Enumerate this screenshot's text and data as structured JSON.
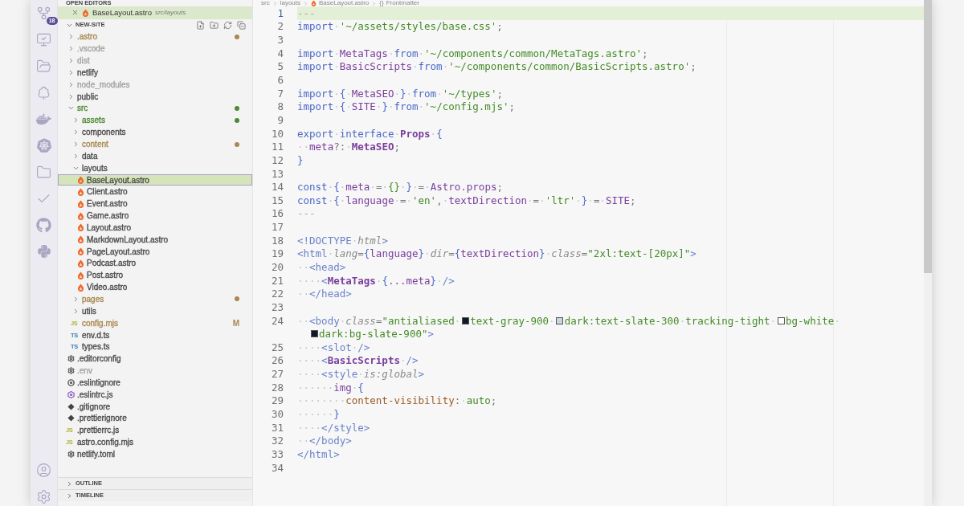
{
  "activity_bar": {
    "source_control_badge": "18"
  },
  "sidebar": {
    "open_editors": {
      "title": "OPEN EDITORS",
      "items": [
        {
          "name": "BaseLayout.astro",
          "description": "src/layouts",
          "kind": "astro",
          "selected": true
        }
      ]
    },
    "explorer": {
      "title": "NEW-SITE",
      "expanded": true,
      "items": [
        {
          "name": ".astro",
          "kind": "folder",
          "expanded": false,
          "selected": false,
          "color": "#a8884f",
          "dot": true
        },
        {
          "name": ".vscode",
          "kind": "folder",
          "expanded": false,
          "selected": false,
          "color": "#a3a3a3"
        },
        {
          "name": "dist",
          "kind": "folder",
          "expanded": false,
          "selected": false,
          "color": "#a3a3a3"
        },
        {
          "name": "netlify",
          "kind": "folder",
          "expanded": false,
          "selected": false,
          "color": "#4a4a4a"
        },
        {
          "name": "node_modules",
          "kind": "folder",
          "expanded": false,
          "selected": false,
          "color": "#a3a3a3"
        },
        {
          "name": "public",
          "kind": "folder",
          "expanded": false,
          "selected": false,
          "color": "#4a4a4a"
        },
        {
          "name": "src",
          "kind": "folder",
          "expanded": true,
          "selected": false,
          "color": "#4e8a34",
          "dot": true,
          "children": [
            {
              "name": "assets",
              "kind": "folder",
              "expanded": false,
              "selected": false,
              "color": "#4e8a34",
              "dot": true
            },
            {
              "name": "components",
              "kind": "folder",
              "expanded": false,
              "selected": false,
              "color": "#4a4a4a"
            },
            {
              "name": "content",
              "kind": "folder",
              "expanded": false,
              "selected": false,
              "color": "#a8884f",
              "dot": true
            },
            {
              "name": "data",
              "kind": "folder",
              "expanded": false,
              "selected": false,
              "color": "#4a4a4a"
            },
            {
              "name": "layouts",
              "kind": "folder",
              "expanded": true,
              "selected": false,
              "color": "#4a4a4a",
              "children": [
                {
                  "name": "BaseLayout.astro",
                  "kind": "astro",
                  "selected": true,
                  "color": "#4a4a4a"
                },
                {
                  "name": "Client.astro",
                  "kind": "astro",
                  "selected": false,
                  "color": "#4a4a4a"
                },
                {
                  "name": "Event.astro",
                  "kind": "astro",
                  "selected": false,
                  "color": "#4a4a4a"
                },
                {
                  "name": "Game.astro",
                  "kind": "astro",
                  "selected": false,
                  "color": "#4a4a4a"
                },
                {
                  "name": "Layout.astro",
                  "kind": "astro",
                  "selected": false,
                  "color": "#4a4a4a"
                },
                {
                  "name": "MarkdownLayout.astro",
                  "kind": "astro",
                  "selected": false,
                  "color": "#4a4a4a"
                },
                {
                  "name": "PageLayout.astro",
                  "kind": "astro",
                  "selected": false,
                  "color": "#4a4a4a"
                },
                {
                  "name": "Podcast.astro",
                  "kind": "astro",
                  "selected": false,
                  "color": "#4a4a4a"
                },
                {
                  "name": "Post.astro",
                  "kind": "astro",
                  "selected": false,
                  "color": "#4a4a4a"
                },
                {
                  "name": "Video.astro",
                  "kind": "astro",
                  "selected": false,
                  "color": "#4a4a4a"
                }
              ]
            },
            {
              "name": "pages",
              "kind": "folder",
              "expanded": false,
              "selected": false,
              "color": "#a8884f",
              "dot": true
            },
            {
              "name": "utils",
              "kind": "folder",
              "expanded": false,
              "selected": false,
              "color": "#4a4a4a"
            },
            {
              "name": "config.mjs",
              "kind": "script",
              "icon": "JS",
              "selected": false,
              "color": "#a8884f",
              "badge": "M"
            },
            {
              "name": "env.d.ts",
              "kind": "typescript",
              "icon": "TS",
              "selected": false,
              "color": "#4a4a4a"
            },
            {
              "name": "types.ts",
              "kind": "typescript",
              "icon": "TS",
              "selected": false,
              "color": "#4a4a4a"
            }
          ]
        },
        {
          "name": ".editorconfig",
          "kind": "config",
          "selected": false,
          "color": "#4a4a4a"
        },
        {
          "name": ".env",
          "kind": "config",
          "selected": false,
          "color": "#a3a3a3"
        },
        {
          "name": ".eslintignore",
          "kind": "eslintignore",
          "selected": false,
          "color": "#4a4a4a"
        },
        {
          "name": ".eslintrc.js",
          "kind": "eslint",
          "selected": false,
          "color": "#4a4a4a"
        },
        {
          "name": ".gitignore",
          "kind": "git",
          "selected": false,
          "color": "#4a4a4a"
        },
        {
          "name": ".prettierignore",
          "kind": "git",
          "selected": false,
          "color": "#4a4a4a"
        },
        {
          "name": ".prettierrc.js",
          "kind": "script",
          "icon": "JS",
          "selected": false,
          "color": "#4a4a4a"
        },
        {
          "name": "astro.config.mjs",
          "kind": "script",
          "icon": "JS",
          "selected": false,
          "color": "#4a4a4a"
        },
        {
          "name": "netlify.toml",
          "kind": "config",
          "selected": false,
          "color": "#4a4a4a"
        }
      ]
    },
    "panels": [
      {
        "title": "OUTLINE",
        "expanded": false
      },
      {
        "title": "TIMELINE",
        "expanded": false
      }
    ]
  },
  "editor": {
    "breadcrumbs": [
      {
        "label": "src",
        "kind": "folder"
      },
      {
        "label": "layouts",
        "kind": "folder"
      },
      {
        "label": "BaseLayout.astro",
        "kind": "astro"
      },
      {
        "label": "Frontmatter",
        "kind": "symbol",
        "icon": "{}"
      }
    ],
    "lines": [
      {
        "n": "1",
        "active": true,
        "tokens": [
          {
            "kind": "dim",
            "t": "---"
          }
        ]
      },
      {
        "n": "2",
        "active": false,
        "tokens": [
          {
            "kind": "kw",
            "t": "import"
          },
          {
            "kind": "ws",
            "t": "·"
          },
          {
            "kind": "str",
            "t": "'~/assets/styles/base.css'"
          },
          {
            "kind": "p",
            "t": ";"
          }
        ]
      },
      {
        "n": "3",
        "active": false
      },
      {
        "n": "4",
        "active": false,
        "tokens": [
          {
            "kind": "kw",
            "t": "import"
          },
          {
            "kind": "ws",
            "t": "·"
          },
          {
            "kind": "id",
            "t": "MetaTags"
          },
          {
            "kind": "ws",
            "t": "·"
          },
          {
            "kind": "kw",
            "t": "from"
          },
          {
            "kind": "ws",
            "t": "·"
          },
          {
            "kind": "str",
            "t": "'~/components/common/MetaTags.astro'"
          },
          {
            "kind": "p",
            "t": ";"
          }
        ]
      },
      {
        "n": "5",
        "active": false,
        "tokens": [
          {
            "kind": "kw",
            "t": "import"
          },
          {
            "kind": "ws",
            "t": "·"
          },
          {
            "kind": "id",
            "t": "BasicScripts"
          },
          {
            "kind": "ws",
            "t": "·"
          },
          {
            "kind": "kw",
            "t": "from"
          },
          {
            "kind": "ws",
            "t": "·"
          },
          {
            "kind": "str",
            "t": "'~/components/common/BasicScripts.astro'"
          },
          {
            "kind": "p",
            "t": ";"
          }
        ]
      },
      {
        "n": "6",
        "active": false
      },
      {
        "n": "7",
        "active": false,
        "tokens": [
          {
            "kind": "kw",
            "t": "import"
          },
          {
            "kind": "ws",
            "t": "·"
          },
          {
            "kind": "brace",
            "t": "{"
          },
          {
            "kind": "ws",
            "t": "·"
          },
          {
            "kind": "id",
            "t": "MetaSEO"
          },
          {
            "kind": "ws",
            "t": "·"
          },
          {
            "kind": "brace",
            "t": "}"
          },
          {
            "kind": "ws",
            "t": "·"
          },
          {
            "kind": "kw",
            "t": "from"
          },
          {
            "kind": "ws",
            "t": "·"
          },
          {
            "kind": "str",
            "t": "'~/types'"
          },
          {
            "kind": "p",
            "t": ";"
          }
        ]
      },
      {
        "n": "8",
        "active": false,
        "tokens": [
          {
            "kind": "kw",
            "t": "import"
          },
          {
            "kind": "ws",
            "t": "·"
          },
          {
            "kind": "brace",
            "t": "{"
          },
          {
            "kind": "ws",
            "t": "·"
          },
          {
            "kind": "id",
            "t": "SITE"
          },
          {
            "kind": "ws",
            "t": "·"
          },
          {
            "kind": "brace",
            "t": "}"
          },
          {
            "kind": "ws",
            "t": "·"
          },
          {
            "kind": "kw",
            "t": "from"
          },
          {
            "kind": "ws",
            "t": "·"
          },
          {
            "kind": "str",
            "t": "'~/config.mjs'"
          },
          {
            "kind": "p",
            "t": ";"
          }
        ]
      },
      {
        "n": "9",
        "active": false
      },
      {
        "n": "10",
        "active": false,
        "tokens": [
          {
            "kind": "kw",
            "t": "export"
          },
          {
            "kind": "ws",
            "t": "·"
          },
          {
            "kind": "kw",
            "t": "interface"
          },
          {
            "kind": "ws",
            "t": "·"
          },
          {
            "kind": "type",
            "t": "Props"
          },
          {
            "kind": "ws",
            "t": "·"
          },
          {
            "kind": "brace",
            "t": "{"
          }
        ]
      },
      {
        "n": "11",
        "active": false,
        "tokens": [
          {
            "kind": "ws",
            "t": "··"
          },
          {
            "kind": "id",
            "t": "meta"
          },
          {
            "kind": "p",
            "t": "?:"
          },
          {
            "kind": "ws",
            "t": "·"
          },
          {
            "kind": "type",
            "t": "MetaSEO"
          },
          {
            "kind": "p",
            "t": ";"
          }
        ]
      },
      {
        "n": "12",
        "active": false,
        "tokens": [
          {
            "kind": "brace",
            "t": "}"
          }
        ]
      },
      {
        "n": "13",
        "active": false
      },
      {
        "n": "14",
        "active": false,
        "tokens": [
          {
            "kind": "kw",
            "t": "const"
          },
          {
            "kind": "ws",
            "t": "·"
          },
          {
            "kind": "brace",
            "t": "{"
          },
          {
            "kind": "ws",
            "t": "·"
          },
          {
            "kind": "id",
            "t": "meta"
          },
          {
            "kind": "ws",
            "t": "·"
          },
          {
            "kind": "p",
            "t": "="
          },
          {
            "kind": "ws",
            "t": "·"
          },
          {
            "kind": "str",
            "t": "{}"
          },
          {
            "kind": "ws",
            "t": "·"
          },
          {
            "kind": "brace",
            "t": "}"
          },
          {
            "kind": "ws",
            "t": "·"
          },
          {
            "kind": "p",
            "t": "="
          },
          {
            "kind": "ws",
            "t": "·"
          },
          {
            "kind": "id",
            "t": "Astro.props"
          },
          {
            "kind": "p",
            "t": ";"
          }
        ]
      },
      {
        "n": "15",
        "active": false,
        "tokens": [
          {
            "kind": "kw",
            "t": "const"
          },
          {
            "kind": "ws",
            "t": "·"
          },
          {
            "kind": "brace",
            "t": "{"
          },
          {
            "kind": "ws",
            "t": "·"
          },
          {
            "kind": "id",
            "t": "language"
          },
          {
            "kind": "ws",
            "t": "·"
          },
          {
            "kind": "p",
            "t": "="
          },
          {
            "kind": "ws",
            "t": "·"
          },
          {
            "kind": "str",
            "t": "'en'"
          },
          {
            "kind": "p",
            "t": ","
          },
          {
            "kind": "ws",
            "t": "·"
          },
          {
            "kind": "id",
            "t": "textDirection"
          },
          {
            "kind": "ws",
            "t": "·"
          },
          {
            "kind": "p",
            "t": "="
          },
          {
            "kind": "ws",
            "t": "·"
          },
          {
            "kind": "str",
            "t": "'ltr'"
          },
          {
            "kind": "ws",
            "t": "·"
          },
          {
            "kind": "brace",
            "t": "}"
          },
          {
            "kind": "ws",
            "t": "·"
          },
          {
            "kind": "p",
            "t": "="
          },
          {
            "kind": "ws",
            "t": "·"
          },
          {
            "kind": "id",
            "t": "SITE"
          },
          {
            "kind": "p",
            "t": ";"
          }
        ]
      },
      {
        "n": "16",
        "active": false,
        "tokens": [
          {
            "kind": "dim",
            "t": "---"
          }
        ]
      },
      {
        "n": "17",
        "active": false
      },
      {
        "n": "18",
        "active": false,
        "tokens": [
          {
            "kind": "tag",
            "t": "<!DOCTYPE"
          },
          {
            "kind": "ws",
            "t": "·"
          },
          {
            "kind": "attr",
            "t": "html"
          },
          {
            "kind": "tag",
            "t": ">"
          }
        ]
      },
      {
        "n": "19",
        "active": false,
        "tokens": [
          {
            "kind": "tag",
            "t": "<html"
          },
          {
            "kind": "ws",
            "t": "·"
          },
          {
            "kind": "attr",
            "t": "lang"
          },
          {
            "kind": "p",
            "t": "="
          },
          {
            "kind": "brace",
            "t": "{"
          },
          {
            "kind": "id",
            "t": "language"
          },
          {
            "kind": "brace",
            "t": "}"
          },
          {
            "kind": "ws",
            "t": "·"
          },
          {
            "kind": "attr",
            "t": "dir"
          },
          {
            "kind": "p",
            "t": "="
          },
          {
            "kind": "brace",
            "t": "{"
          },
          {
            "kind": "id",
            "t": "textDirection"
          },
          {
            "kind": "brace",
            "t": "}"
          },
          {
            "kind": "ws",
            "t": "·"
          },
          {
            "kind": "attr",
            "t": "class"
          },
          {
            "kind": "p",
            "t": "="
          },
          {
            "kind": "str",
            "t": "\"2xl:text-[20px]\""
          },
          {
            "kind": "tag",
            "t": ">"
          }
        ]
      },
      {
        "n": "20",
        "active": false,
        "tokens": [
          {
            "kind": "ws",
            "t": "··"
          },
          {
            "kind": "tag",
            "t": "<head>"
          }
        ]
      },
      {
        "n": "21",
        "active": false,
        "tokens": [
          {
            "kind": "ws",
            "t": "····"
          },
          {
            "kind": "tag",
            "t": "<"
          },
          {
            "kind": "type",
            "t": "MetaTags"
          },
          {
            "kind": "ws",
            "t": "·"
          },
          {
            "kind": "brace",
            "t": "{"
          },
          {
            "kind": "id",
            "t": "...meta"
          },
          {
            "kind": "brace",
            "t": "}"
          },
          {
            "kind": "ws",
            "t": "·"
          },
          {
            "kind": "tag",
            "t": "/>"
          }
        ]
      },
      {
        "n": "22",
        "active": false,
        "tokens": [
          {
            "kind": "ws",
            "t": "··"
          },
          {
            "kind": "tag",
            "t": "</head>"
          }
        ]
      },
      {
        "n": "23",
        "active": false
      },
      {
        "n": "24",
        "active": false,
        "tokens": [
          {
            "kind": "ws",
            "t": "··"
          },
          {
            "kind": "tag",
            "t": "<body"
          },
          {
            "kind": "ws",
            "t": "·"
          },
          {
            "kind": "attr",
            "t": "class"
          },
          {
            "kind": "p",
            "t": "="
          },
          {
            "kind": "str",
            "t": "\"antialiased"
          },
          {
            "kind": "ws",
            "t": "·"
          },
          {
            "kind": "swatch",
            "color": "#111827"
          },
          {
            "kind": "str",
            "t": "text-gray-900"
          },
          {
            "kind": "ws",
            "t": "·"
          },
          {
            "kind": "swatch",
            "color": "#cbd5e1"
          },
          {
            "kind": "str",
            "t": "dark:text-slate-300"
          },
          {
            "kind": "ws",
            "t": "·"
          },
          {
            "kind": "str",
            "t": "tracking-tight"
          },
          {
            "kind": "ws",
            "t": "·"
          },
          {
            "kind": "swatch",
            "color": "#ffffff"
          },
          {
            "kind": "str",
            "t": "bg-white"
          },
          {
            "kind": "ws",
            "t": "·"
          }
        ],
        "wrap": [
          {
            "kind": "swatch",
            "color": "#0f172a"
          },
          {
            "kind": "str",
            "t": "dark:bg-slate-900\""
          },
          {
            "kind": "tag",
            "t": ">"
          }
        ]
      },
      {
        "n": "25",
        "active": false,
        "tokens": [
          {
            "kind": "ws",
            "t": "····"
          },
          {
            "kind": "tag",
            "t": "<slot"
          },
          {
            "kind": "ws",
            "t": "·"
          },
          {
            "kind": "tag",
            "t": "/>"
          }
        ]
      },
      {
        "n": "26",
        "active": false,
        "tokens": [
          {
            "kind": "ws",
            "t": "····"
          },
          {
            "kind": "tag",
            "t": "<"
          },
          {
            "kind": "type",
            "t": "BasicScripts"
          },
          {
            "kind": "ws",
            "t": "·"
          },
          {
            "kind": "tag",
            "t": "/>"
          }
        ]
      },
      {
        "n": "27",
        "active": false,
        "tokens": [
          {
            "kind": "ws",
            "t": "····"
          },
          {
            "kind": "tag",
            "t": "<style"
          },
          {
            "kind": "ws",
            "t": "·"
          },
          {
            "kind": "attr",
            "t": "is:global"
          },
          {
            "kind": "tag",
            "t": ">"
          }
        ]
      },
      {
        "n": "28",
        "active": false,
        "tokens": [
          {
            "kind": "ws",
            "t": "······"
          },
          {
            "kind": "id",
            "t": "img"
          },
          {
            "kind": "ws",
            "t": "·"
          },
          {
            "kind": "brace",
            "t": "{"
          }
        ]
      },
      {
        "n": "29",
        "active": false,
        "tokens": [
          {
            "kind": "ws",
            "t": "········"
          },
          {
            "kind": "prop",
            "t": "content-visibility"
          },
          {
            "kind": "p",
            "t": ":"
          },
          {
            "kind": "ws",
            "t": "·"
          },
          {
            "kind": "str",
            "t": "auto"
          },
          {
            "kind": "p",
            "t": ";"
          }
        ]
      },
      {
        "n": "30",
        "active": false,
        "tokens": [
          {
            "kind": "ws",
            "t": "······"
          },
          {
            "kind": "brace",
            "t": "}"
          }
        ]
      },
      {
        "n": "31",
        "active": false,
        "tokens": [
          {
            "kind": "ws",
            "t": "····"
          },
          {
            "kind": "tag",
            "t": "</style>"
          }
        ]
      },
      {
        "n": "32",
        "active": false,
        "tokens": [
          {
            "kind": "ws",
            "t": "··"
          },
          {
            "kind": "tag",
            "t": "</body>"
          }
        ]
      },
      {
        "n": "33",
        "active": false,
        "tokens": [
          {
            "kind": "tag",
            "t": "</html>"
          }
        ]
      },
      {
        "n": "34",
        "active": false
      }
    ]
  }
}
